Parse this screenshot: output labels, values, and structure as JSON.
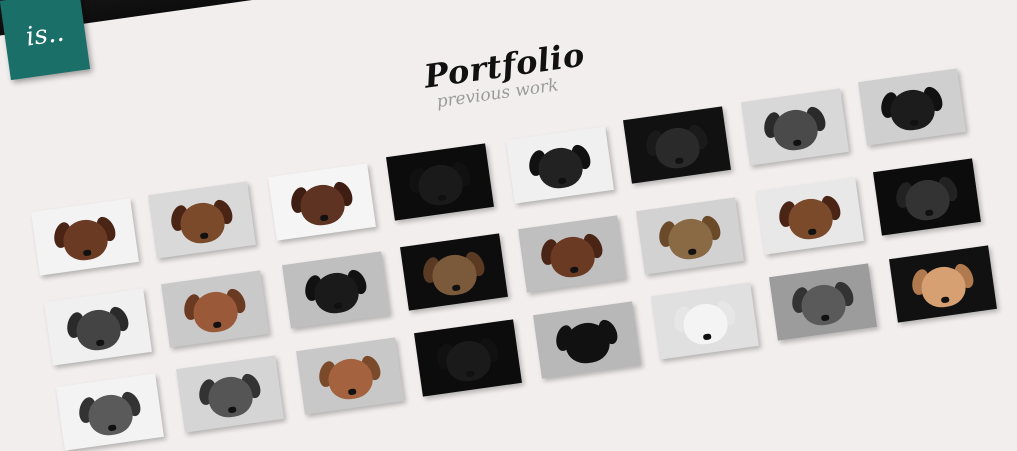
{
  "logo": {
    "text": "is.."
  },
  "heading": {
    "title": "Portfolio",
    "subtitle": "previous work"
  },
  "tiles": [
    {
      "bg": "#f3f3f3",
      "dog": "#6b3a23",
      "ear": "#4a2414",
      "name": "springer-spaniel-liver"
    },
    {
      "bg": "#d9d9d9",
      "dog": "#7a4a2a",
      "ear": "#4a2414",
      "name": "spaniel-white"
    },
    {
      "bg": "#f5f5f5",
      "dog": "#5e3322",
      "ear": "#3e1e12",
      "name": "spaniel-lying"
    },
    {
      "bg": "#0c0c0c",
      "dog": "#1a1a1a",
      "ear": "#111",
      "name": "doberman-black"
    },
    {
      "bg": "#f0f0f0",
      "dog": "#222",
      "ear": "#111",
      "name": "spaniel-bw"
    },
    {
      "bg": "#111",
      "dog": "#2a2a2a",
      "ear": "#1a1a1a",
      "name": "spaniel-dark"
    },
    {
      "bg": "#d8d8d8",
      "dog": "#4a4a4a",
      "ear": "#2a2a2a",
      "name": "mastiff-bw"
    },
    {
      "bg": "#cfcfcf",
      "dog": "#1c1c1c",
      "ear": "#111",
      "name": "doberman-grey"
    },
    {
      "bg": "#f0f0f0",
      "dog": "#444",
      "ear": "#2a2a2a",
      "name": "terrier-bw"
    },
    {
      "bg": "#c9c9c9",
      "dog": "#9a5a3a",
      "ear": "#6b3a23",
      "name": "dogue-de-bordeaux"
    },
    {
      "bg": "#bfbfbf",
      "dog": "#1a1a1a",
      "ear": "#111",
      "name": "dobermann-profile"
    },
    {
      "bg": "#0d0d0d",
      "dog": "#7a5a3a",
      "ear": "#5a3a22",
      "name": "border-terrier"
    },
    {
      "bg": "#bfbfbf",
      "dog": "#6b3a23",
      "ear": "#4a2414",
      "name": "spaniel-studio"
    },
    {
      "bg": "#d2d2d2",
      "dog": "#8a6a44",
      "ear": "#6b4a2a",
      "name": "terrier-tan"
    },
    {
      "bg": "#e8e8e8",
      "dog": "#7a4a2a",
      "ear": "#4a2414",
      "name": "spaniel-sitting"
    },
    {
      "bg": "#0c0c0c",
      "dog": "#333",
      "ear": "#222",
      "name": "spaniel-black"
    },
    {
      "bg": "#f3f3f3",
      "dog": "#5a5a5a",
      "ear": "#333",
      "name": "dog-bw-bottom"
    },
    {
      "bg": "#d5d5d5",
      "dog": "#555",
      "ear": "#333",
      "name": "spaniel-bw-bottom"
    },
    {
      "bg": "#c8c8c8",
      "dog": "#a4633e",
      "ear": "#7a4a2a",
      "name": "boxer"
    },
    {
      "bg": "#0c0c0c",
      "dog": "#1a1a1a",
      "ear": "#111",
      "name": "labrador-black"
    },
    {
      "bg": "#b8b8b8",
      "dog": "#111",
      "ear": "#111",
      "name": "border-collie"
    },
    {
      "bg": "#e0e0e0",
      "dog": "#f4f4f4",
      "ear": "#e6e6e6",
      "name": "westie"
    },
    {
      "bg": "#9c9c9c",
      "dog": "#5a5a5a",
      "ear": "#333",
      "name": "pug-bw"
    },
    {
      "bg": "#111",
      "dog": "#d6a072",
      "ear": "#b07a4e",
      "name": "golden-puppy"
    }
  ]
}
